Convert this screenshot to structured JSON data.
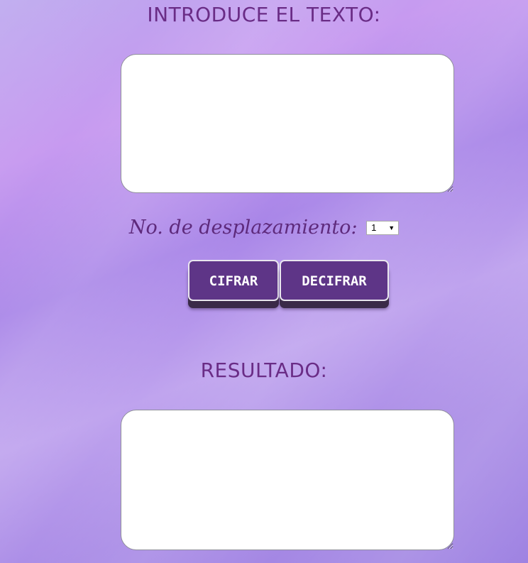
{
  "input_section": {
    "heading": "INTRODUCE EL TEXTO:",
    "textarea_value": ""
  },
  "shift": {
    "label": "No. de desplazamiento:",
    "selected_value": "1"
  },
  "buttons": {
    "cipher_label": "CIFRAR",
    "decipher_label": "DECIFRAR"
  },
  "result_section": {
    "heading": "RESULTADO:",
    "textarea_value": ""
  },
  "colors": {
    "heading": "#6a2c86",
    "button_bg": "#5e3587",
    "button_border": "#e9e6ee",
    "button_shadow": "#3a2a48"
  },
  "icons": {
    "select_arrow": "chevron-down-icon"
  }
}
